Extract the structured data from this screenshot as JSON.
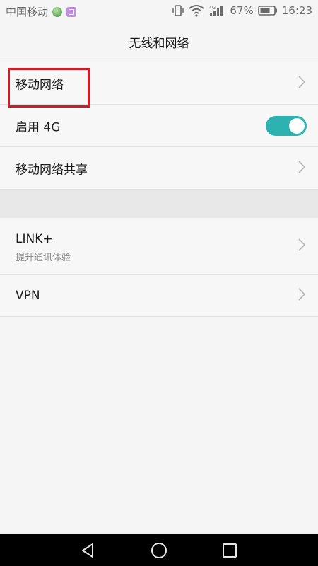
{
  "status_bar": {
    "carrier": "中国移动",
    "battery_percent": "67%",
    "time": "16:23",
    "network_type": "4G",
    "icons": [
      "app-notification-icon",
      "gallery-notification-icon",
      "vibrate-icon",
      "wifi-icon",
      "signal-icon",
      "battery-icon"
    ]
  },
  "header": {
    "title": "无线和网络"
  },
  "settings": {
    "items": [
      {
        "label": "移动网络",
        "type": "link"
      },
      {
        "label": "启用 4G",
        "type": "toggle",
        "enabled": true
      },
      {
        "label": "移动网络共享",
        "type": "link"
      }
    ]
  },
  "settings2": {
    "items": [
      {
        "label": "LINK+",
        "sublabel": "提升通讯体验",
        "type": "link"
      },
      {
        "label": "VPN",
        "type": "link"
      }
    ]
  },
  "colors": {
    "accent": "#2db2b1",
    "highlight": "#d7191f"
  },
  "nav_bar": {
    "buttons": [
      "back-icon",
      "home-icon",
      "recents-icon"
    ]
  }
}
